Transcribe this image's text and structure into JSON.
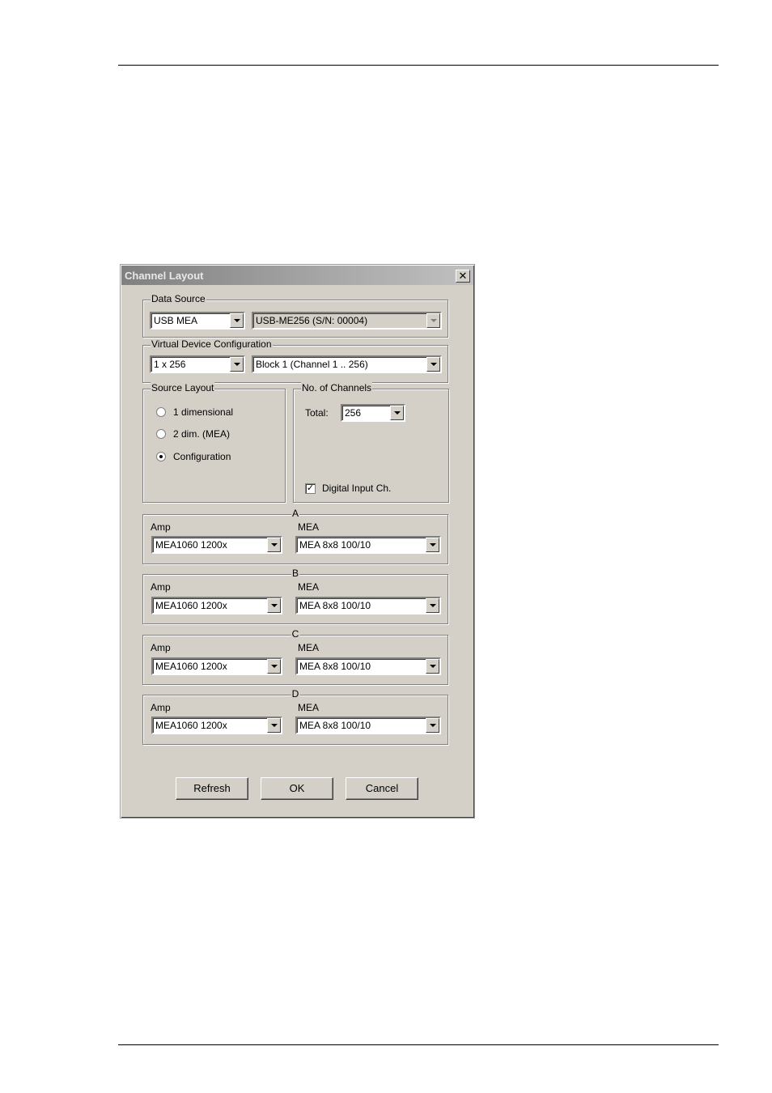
{
  "dialog": {
    "title": "Channel Layout",
    "close_label": "✕"
  },
  "data_source": {
    "legend": "Data Source",
    "type_value": "USB MEA",
    "device_value": "USB-ME256  (S/N: 00004)"
  },
  "virtual_device": {
    "legend": "Virtual Device Configuration",
    "config_value": "1 x 256",
    "block_value": "Block 1 (Channel 1 .. 256)"
  },
  "source_layout": {
    "legend": "Source Layout",
    "options": [
      "1 dimensional",
      "2 dim. (MEA)",
      "Configuration"
    ],
    "selected": "Configuration"
  },
  "channels": {
    "legend": "No. of Channels",
    "total_label": "Total:",
    "total_value": "256",
    "digital_input_label": "Digital Input Ch.",
    "digital_input_checked": true,
    "check_mark": "✓"
  },
  "amp_sections": [
    {
      "legend": "A",
      "amp_label": "Amp",
      "amp_value": "MEA1060 1200x",
      "mea_label": "MEA",
      "mea_value": "MEA 8x8 100/10"
    },
    {
      "legend": "B",
      "amp_label": "Amp",
      "amp_value": "MEA1060 1200x",
      "mea_label": "MEA",
      "mea_value": "MEA 8x8 100/10"
    },
    {
      "legend": "C",
      "amp_label": "Amp",
      "amp_value": "MEA1060 1200x",
      "mea_label": "MEA",
      "mea_value": "MEA 8x8 100/10"
    },
    {
      "legend": "D",
      "amp_label": "Amp",
      "amp_value": "MEA1060 1200x",
      "mea_label": "MEA",
      "mea_value": "MEA 8x8 100/10"
    }
  ],
  "buttons": {
    "refresh": "Refresh",
    "ok": "OK",
    "cancel": "Cancel"
  }
}
